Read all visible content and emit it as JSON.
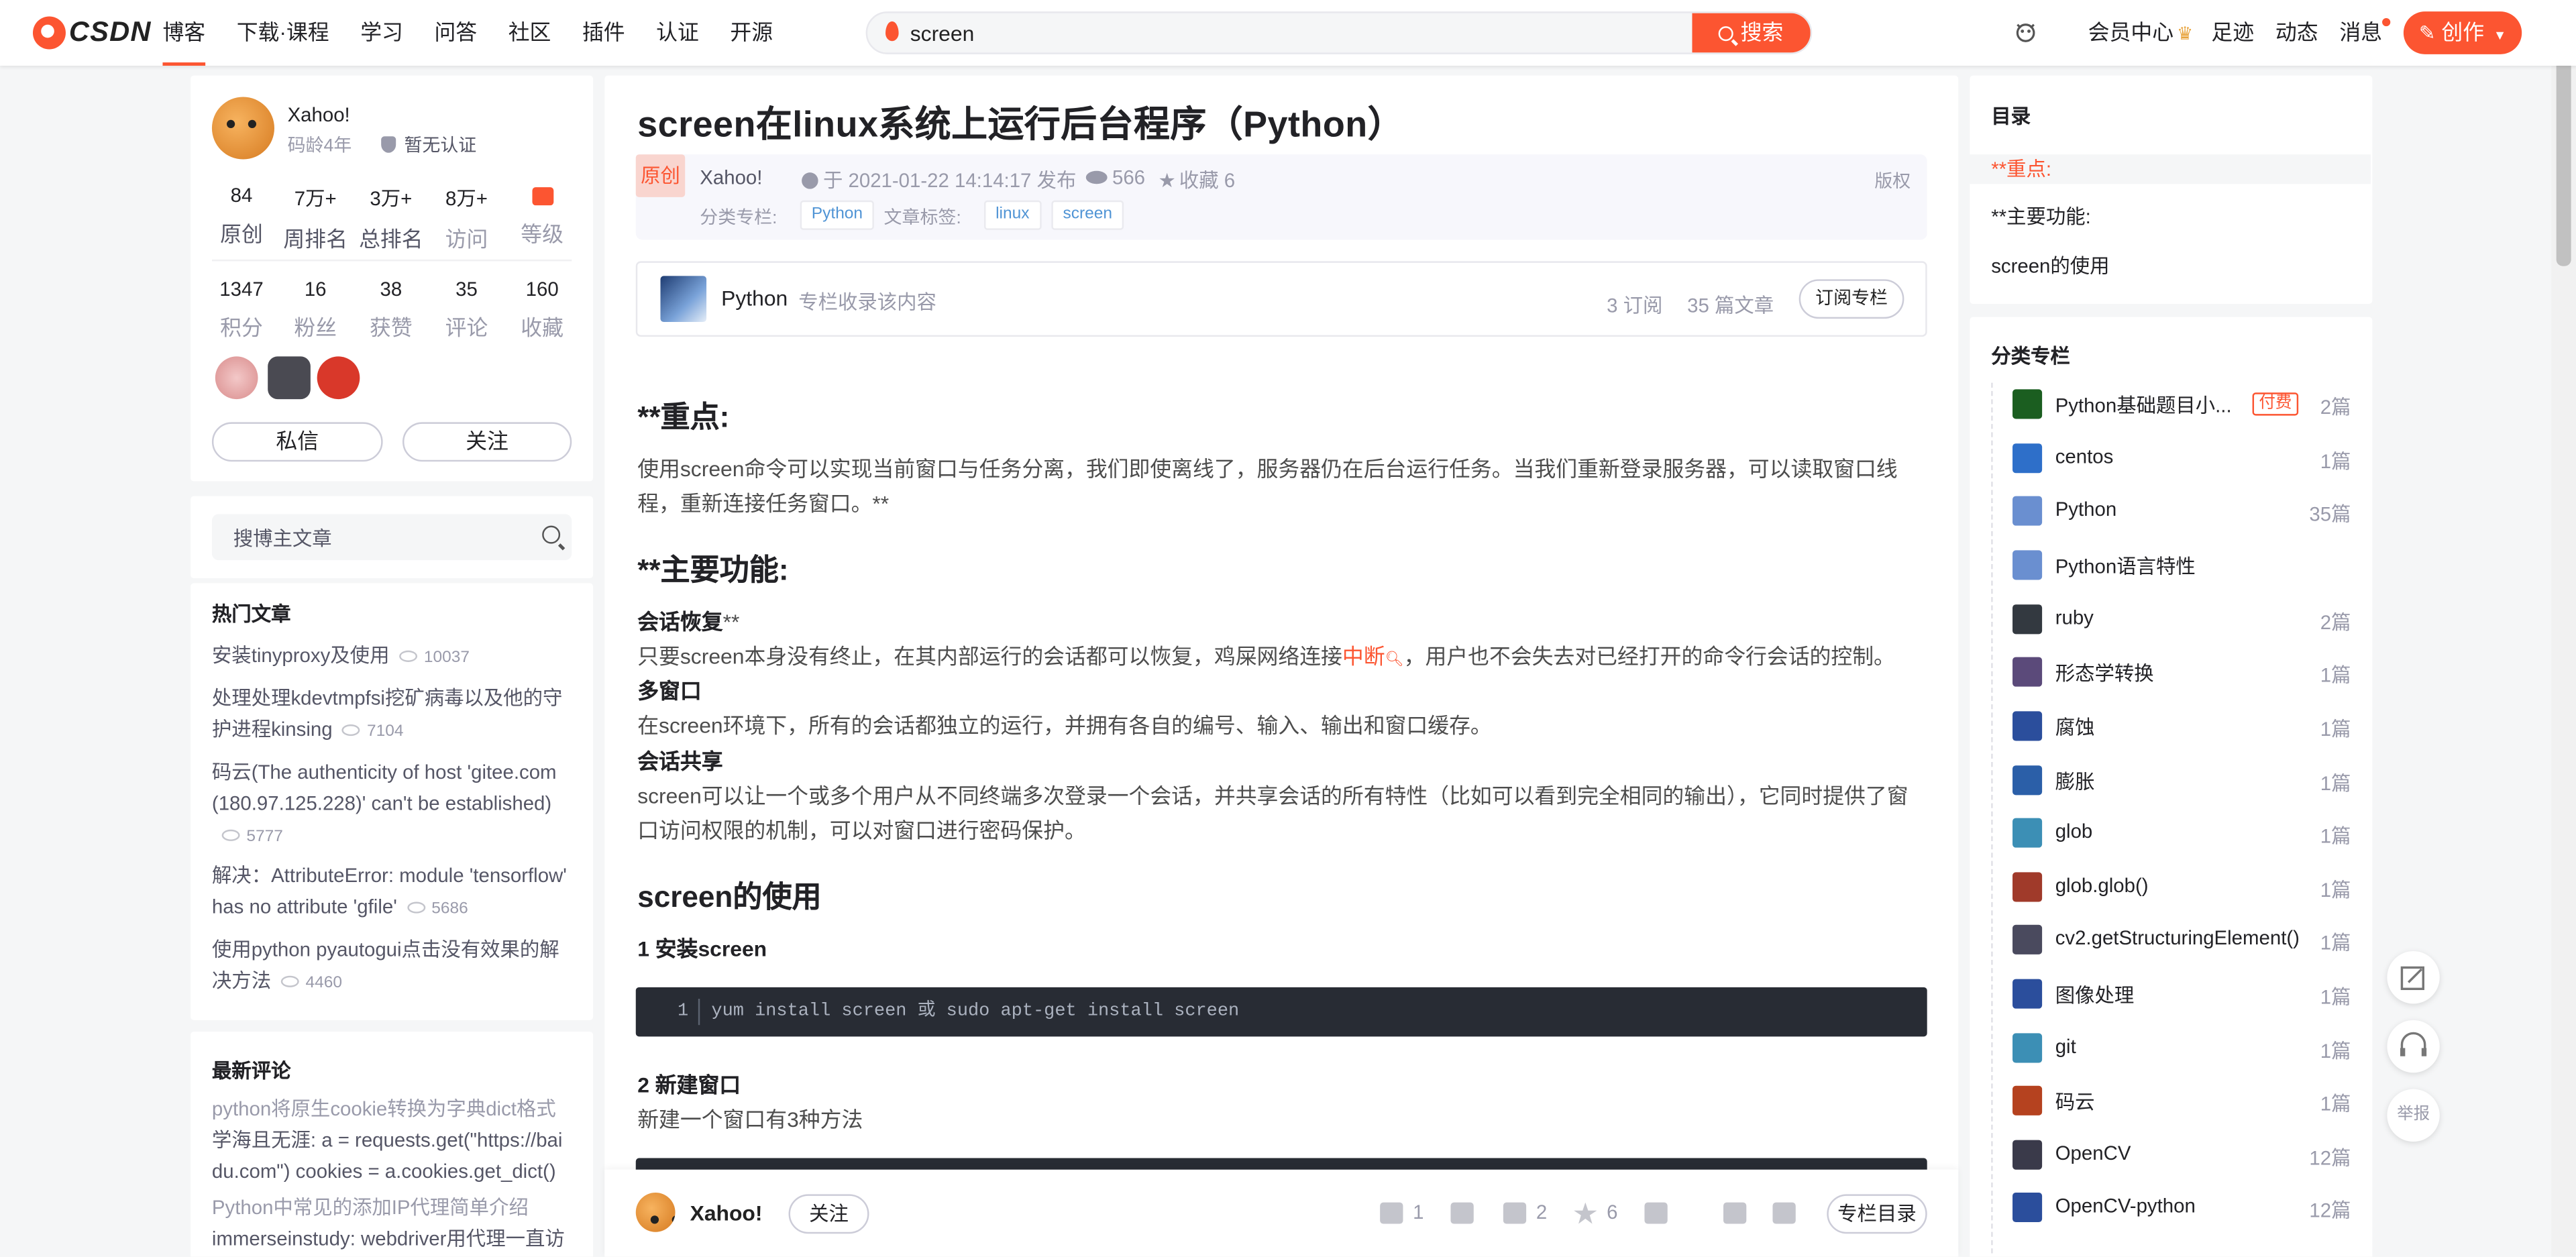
{
  "toolbar": {
    "logo_text": "CSDN",
    "nav": [
      "博客",
      "下载·课程",
      "学习",
      "问答",
      "社区",
      "插件",
      "认证",
      "开源"
    ],
    "search_value": "screen",
    "search_button": "搜索",
    "vip": "会员中心",
    "footprint": "足迹",
    "dynamic": "动态",
    "messages": "消息",
    "create": "创作"
  },
  "profile": {
    "name": "Xahoo!",
    "code_age": "码龄4年",
    "cert": "暂无认证",
    "stats1": [
      {
        "n": "84",
        "l": "原创"
      },
      {
        "n": "7万+",
        "l": "周排名"
      },
      {
        "n": "3万+",
        "l": "总排名"
      },
      {
        "n": "8万+",
        "l": "访问"
      },
      {
        "n": "",
        "l": "等级"
      }
    ],
    "stats2": [
      {
        "n": "1347",
        "l": "积分"
      },
      {
        "n": "16",
        "l": "粉丝"
      },
      {
        "n": "38",
        "l": "获赞"
      },
      {
        "n": "35",
        "l": "评论"
      },
      {
        "n": "160",
        "l": "收藏"
      }
    ],
    "message_btn": "私信",
    "follow_btn": "关注"
  },
  "blog_search": {
    "placeholder": "搜博主文章"
  },
  "hot": {
    "title": "热门文章",
    "items": [
      {
        "title": "安装tinyproxy及使用",
        "views": "10037"
      },
      {
        "title": "处理处理kdevtmpfsi挖矿病毒以及他的守护进程kinsing",
        "views": "7104"
      },
      {
        "title": "码云(The authenticity of host 'gitee.com (180.97.125.228)' can't be established)",
        "views": "5777"
      },
      {
        "title": "解决：AttributeError: module 'tensorflow' has no attribute 'gfile'",
        "views": "5686"
      },
      {
        "title": "使用python pyautogui点击没有效果的解决方法",
        "views": "4460"
      }
    ]
  },
  "comments": {
    "title": "最新评论",
    "items": [
      {
        "article": "python将原生cookie转换为字典dict格式",
        "text": "学海且无涯: a = requests.get(\"https://baidu.com\") cookies = a.cookies.get_dict()"
      },
      {
        "article": "Python中常见的添加IP代理简单介绍",
        "text": "immerseinstudy: webdriver用代理一直访问"
      }
    ]
  },
  "article": {
    "title": "screen在linux系统上运行后台程序（Python）",
    "original": "原创",
    "author": "Xahoo!",
    "published": "于 2021-01-22 14:14:17 发布",
    "views": "566",
    "favorites": "收藏 6",
    "copyright": "版权",
    "category_label": "分类专栏:",
    "category": "Python",
    "tag_label": "文章标签:",
    "tags": [
      "linux",
      "screen"
    ],
    "column": {
      "name": "Python",
      "desc": "专栏收录该内容",
      "subs": "3 订阅",
      "count": "35 篇文章",
      "button": "订阅专栏"
    },
    "h_key": "**重点:",
    "p_key": "使用screen命令可以实现当前窗口与任务分离，我们即使离线了，服务器仍在后台运行任务。当我们重新登录服务器，可以读取窗口线程，重新连接任务窗口。**",
    "h_func": "**主要功能:",
    "f1_title": "会话恢复",
    "f1_suffix": "**",
    "f1_a": "只要screen本身没有终止，在其内部运行的会话都可以恢复，鸡屎网络连接",
    "f1_link": "中断",
    "f1_b": "，用户也不会失去对已经打开的命令行会话的控制。",
    "f2_title": "多窗口",
    "f2_text": "在screen环境下，所有的会话都独立的运行，并拥有各自的编号、输入、输出和窗口缓存。",
    "f3_title": "会话共享",
    "f3_text": "screen可以让一个或多个用户从不同终端多次登录一个会话，并共享会话的所有特性（比如可以看到完全相同的输出），它同时提供了窗口访问权限的机制，可以对窗口进行密码保护。",
    "h_use": "screen的使用",
    "s1": "1 安装screen",
    "code_line": "1",
    "code1": "yum install screen  或 sudo apt-get install screen",
    "s2": "2 新建窗口",
    "s2_text": "新建一个窗口有3种方法"
  },
  "bottom": {
    "author": "Xahoo!",
    "follow": "关注",
    "likes": "1",
    "comments": "2",
    "stars": "6",
    "toc_btn": "专栏目录"
  },
  "toc": {
    "title": "目录",
    "items": [
      "**重点:",
      "**主要功能:",
      "screen的使用"
    ]
  },
  "categories": {
    "title": "分类专栏",
    "paid": "付费",
    "items": [
      {
        "name": "Python基础题目小...",
        "count": "2篇",
        "color": "#1b5e20"
      },
      {
        "name": "centos",
        "count": "1篇",
        "color": "#2e6fc9"
      },
      {
        "name": "Python",
        "count": "35篇",
        "color": "#6a8fd0"
      },
      {
        "name": "Python语言特性",
        "count": "",
        "color": "#6a8fd0"
      },
      {
        "name": "ruby",
        "count": "2篇",
        "color": "#333940"
      },
      {
        "name": "形态学转换",
        "count": "1篇",
        "color": "#5b4a7a"
      },
      {
        "name": "腐蚀",
        "count": "1篇",
        "color": "#2b4e9c"
      },
      {
        "name": "膨胀",
        "count": "1篇",
        "color": "#2b5fa8"
      },
      {
        "name": "glob",
        "count": "1篇",
        "color": "#3c8fb5"
      },
      {
        "name": "glob.glob()",
        "count": "1篇",
        "color": "#a03a2a"
      },
      {
        "name": "cv2.getStructuringElement()",
        "count": "1篇",
        "color": "#4a4a5e"
      },
      {
        "name": "图像处理",
        "count": "1篇",
        "color": "#2b4e9c"
      },
      {
        "name": "git",
        "count": "1篇",
        "color": "#3c8fb5"
      },
      {
        "name": "码云",
        "count": "1篇",
        "color": "#b5421f"
      },
      {
        "name": "OpenCV",
        "count": "12篇",
        "color": "#3a3a4a"
      },
      {
        "name": "OpenCV-python",
        "count": "12篇",
        "color": "#2b4e9c"
      }
    ]
  },
  "floating": {
    "report": "举报"
  }
}
